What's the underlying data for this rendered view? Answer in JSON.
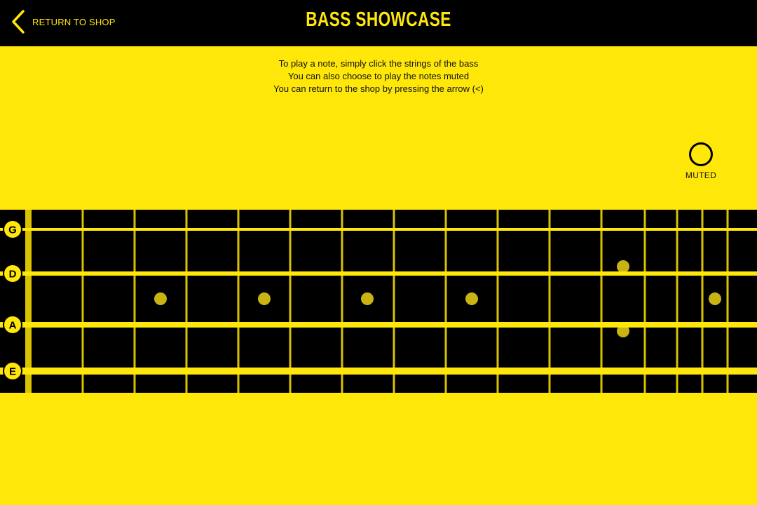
{
  "header": {
    "back_label": "RETURN TO SHOP",
    "title": "BASS SHOWCASE"
  },
  "instructions": [
    "To play a note, simply click the strings of the bass",
    "You can also choose to play the notes muted",
    "You can return to the shop by pressing the arrow (<)"
  ],
  "muted_toggle": {
    "label": "MUTED",
    "checked": false
  },
  "fretboard": {
    "strings": [
      "G",
      "D",
      "A",
      "E"
    ],
    "fret_count": 14,
    "inlay_frets": [
      3,
      5,
      7,
      9,
      12,
      15
    ]
  },
  "colors": {
    "accent": "#FFE70A",
    "background": "#FFE70A",
    "fretboard": "#000000",
    "fret_wire": "#D9C200",
    "inlay": "#C9B414"
  },
  "icons": {
    "back": "chevron-left-icon",
    "muted": "circle-toggle-icon"
  }
}
